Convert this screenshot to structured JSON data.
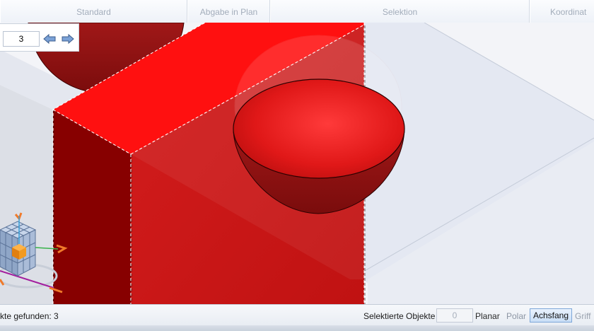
{
  "toolbar": {
    "tabs": [
      {
        "label": "Standard"
      },
      {
        "label": "Abgabe in Plan"
      },
      {
        "label": "Selektion"
      },
      {
        "label": "Koordinat"
      }
    ]
  },
  "counter": {
    "value": "3"
  },
  "viewport": {
    "block_colors": {
      "top": "#ff1212",
      "left": "#880000",
      "front": "#cc1616"
    },
    "sphere_color": "#e81c1c",
    "glass_color": "#dfe5f1"
  },
  "status": {
    "found_text": "kte gefunden: 3",
    "selected_label": "Selektierte Objekte",
    "selected_count": "0",
    "planar": "Planar",
    "polar": "Polar",
    "achsfang": "Achsfang",
    "griff": "Griff"
  },
  "icons": {
    "prev": "arrow-left-icon",
    "next": "arrow-right-icon",
    "navigator": "view-cube-icon"
  }
}
